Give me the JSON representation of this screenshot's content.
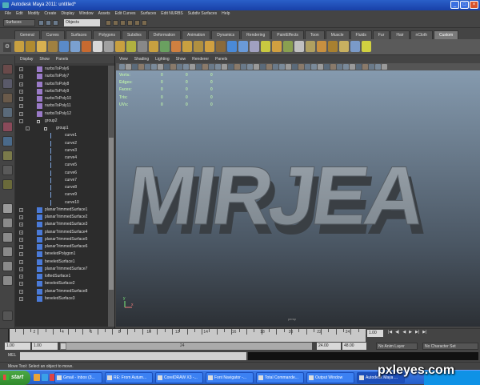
{
  "window": {
    "title": "Autodesk Maya 2011: untitled*",
    "controls": [
      "_",
      "□",
      "×"
    ]
  },
  "menubar": [
    "File",
    "Edit",
    "Modify",
    "Create",
    "Display",
    "Window",
    "Assets",
    "Edit Curves",
    "Surfaces",
    "Edit NURBS",
    "Subdiv Surfaces",
    "Help"
  ],
  "statusline": {
    "mode": "Surfaces",
    "object_field": "Objects"
  },
  "shelf_tabs": [
    "General",
    "Curves",
    "Surfaces",
    "Polygons",
    "Subdivs",
    "Deformation",
    "Animation",
    "Dynamics",
    "Rendering",
    "PaintEffects",
    "Toon",
    "Muscle",
    "Fluids",
    "Fur",
    "Hair",
    "nCloth",
    "Custom"
  ],
  "shelf_active_tab": "Custom",
  "outliner": {
    "menu": [
      "Display",
      "Show",
      "Panels"
    ],
    "items": [
      {
        "label": "nurbsToPoly6",
        "type": "poly",
        "indent": 0,
        "expand": "+"
      },
      {
        "label": "nurbsToPoly7",
        "type": "poly",
        "indent": 0,
        "expand": "+"
      },
      {
        "label": "nurbsToPoly8",
        "type": "poly",
        "indent": 0,
        "expand": "+"
      },
      {
        "label": "nurbsToPoly9",
        "type": "poly",
        "indent": 0,
        "expand": "+"
      },
      {
        "label": "nurbsToPoly10",
        "type": "poly",
        "indent": 0,
        "expand": "+"
      },
      {
        "label": "nurbsToPoly11",
        "type": "poly",
        "indent": 0,
        "expand": "+"
      },
      {
        "label": "nurbsToPoly12",
        "type": "poly",
        "indent": 0,
        "expand": "+"
      },
      {
        "label": "group2",
        "type": "group",
        "indent": 0,
        "expand": "-"
      },
      {
        "label": "group1",
        "type": "group",
        "indent": 1,
        "expand": "-"
      },
      {
        "label": "curve1",
        "type": "curve",
        "indent": 2,
        "expand": ""
      },
      {
        "label": "curve2",
        "type": "curve",
        "indent": 2,
        "expand": ""
      },
      {
        "label": "curve3",
        "type": "curve",
        "indent": 2,
        "expand": ""
      },
      {
        "label": "curve4",
        "type": "curve",
        "indent": 2,
        "expand": ""
      },
      {
        "label": "curve5",
        "type": "curve",
        "indent": 2,
        "expand": ""
      },
      {
        "label": "curve6",
        "type": "curve",
        "indent": 2,
        "expand": ""
      },
      {
        "label": "curve7",
        "type": "curve",
        "indent": 2,
        "expand": ""
      },
      {
        "label": "curve8",
        "type": "curve",
        "indent": 2,
        "expand": ""
      },
      {
        "label": "curve9",
        "type": "curve",
        "indent": 2,
        "expand": ""
      },
      {
        "label": "curve10",
        "type": "curve",
        "indent": 2,
        "expand": ""
      },
      {
        "label": "planarTrimmedSurface1",
        "type": "surface",
        "indent": 0,
        "expand": "+"
      },
      {
        "label": "planarTrimmedSurface2",
        "type": "surface",
        "indent": 0,
        "expand": "+"
      },
      {
        "label": "planarTrimmedSurface3",
        "type": "surface",
        "indent": 0,
        "expand": "+"
      },
      {
        "label": "planarTrimmedSurface4",
        "type": "surface",
        "indent": 0,
        "expand": "+"
      },
      {
        "label": "planarTrimmedSurface5",
        "type": "surface",
        "indent": 0,
        "expand": "+"
      },
      {
        "label": "planarTrimmedSurface6",
        "type": "surface",
        "indent": 0,
        "expand": "+"
      },
      {
        "label": "beveledPolygon1",
        "type": "surface",
        "indent": 0,
        "expand": "+"
      },
      {
        "label": "beveledSurface1",
        "type": "surface",
        "indent": 0,
        "expand": "+"
      },
      {
        "label": "planarTrimmedSurface7",
        "type": "surface",
        "indent": 0,
        "expand": "+"
      },
      {
        "label": "loftedSurface1",
        "type": "surface",
        "indent": 0,
        "expand": "+"
      },
      {
        "label": "beveledSurface2",
        "type": "surface",
        "indent": 0,
        "expand": "+"
      },
      {
        "label": "planarTrimmedSurface8",
        "type": "surface",
        "indent": 0,
        "expand": "+"
      },
      {
        "label": "beveledSurface3",
        "type": "surface",
        "indent": 0,
        "expand": "+"
      }
    ]
  },
  "viewport": {
    "menu": [
      "View",
      "Shading",
      "Lighting",
      "Show",
      "Renderer",
      "Panels"
    ],
    "hud": [
      {
        "label": "Verts:",
        "values": [
          "0",
          "0",
          "0"
        ]
      },
      {
        "label": "Edges:",
        "values": [
          "0",
          "0",
          "0"
        ]
      },
      {
        "label": "Faces:",
        "values": [
          "0",
          "0",
          "0"
        ]
      },
      {
        "label": "Tris:",
        "values": [
          "0",
          "0",
          "0"
        ]
      },
      {
        "label": "UVs:",
        "values": [
          "0",
          "0",
          "0"
        ]
      }
    ],
    "text_3d": "MIRJEA",
    "axis_y": "y",
    "axis_x": "x",
    "persp_label": "persp"
  },
  "timeline": {
    "ticks": [
      "2",
      "4",
      "6",
      "8",
      "10",
      "12",
      "14",
      "16",
      "18",
      "20",
      "22",
      "24"
    ],
    "current_frame": "1.00",
    "play_controls": [
      "|◀",
      "◀|",
      "◀",
      "▶",
      "▶|",
      "▶|"
    ]
  },
  "range": {
    "start": "1.00",
    "anim_start": "1.00",
    "range_mid": "24",
    "range_end": "24.00",
    "anim_end": "48.00",
    "anim_layer": "No Anim Layer",
    "character_set": "No Character Set"
  },
  "cmdline": {
    "label": "MEL"
  },
  "helpline": "Move Tool: Select an object to move.",
  "taskbar": {
    "start": "start",
    "tasks": [
      "Gmail - Inbox (3...",
      "RE: From Autum...",
      "CorelDRAW X3 -...",
      "Font Navigator -...",
      "Total Commande...",
      "Output Window",
      "Autodesk Maya ..."
    ],
    "active_task": 6
  },
  "watermark": "pxleyes.com",
  "colors": {
    "maya_bg": "#444444",
    "hud_text": "#b7e8a9",
    "title_blue": "#2a5fc8",
    "text3d_face": "#8e979f"
  }
}
